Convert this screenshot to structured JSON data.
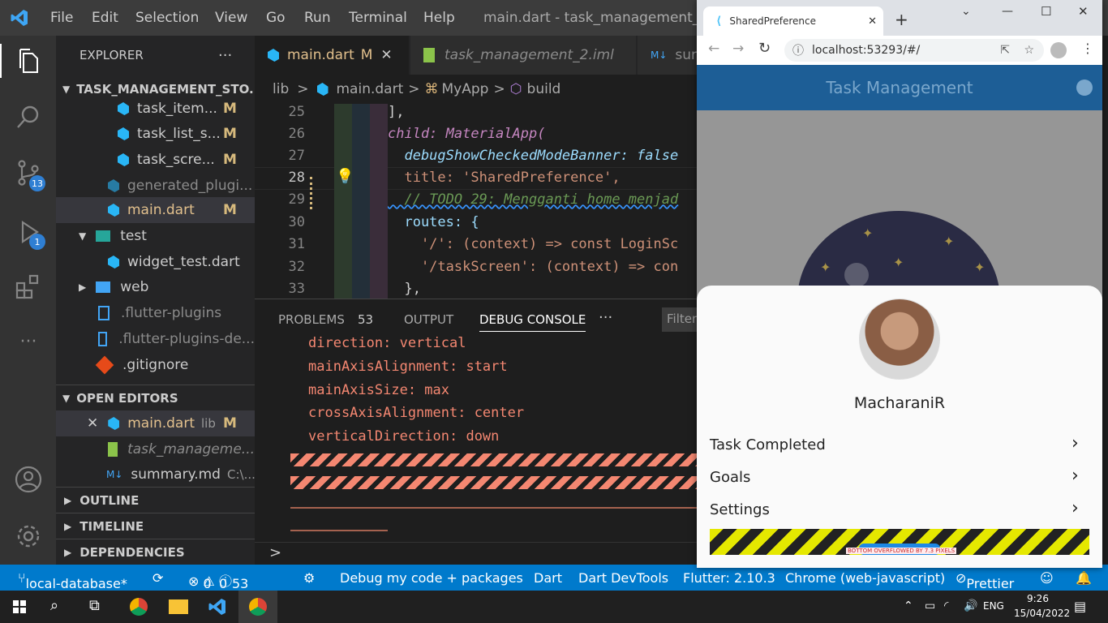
{
  "titlebar": {
    "menus": [
      "File",
      "Edit",
      "Selection",
      "View",
      "Go",
      "Run",
      "Terminal",
      "Help"
    ],
    "title": "main.dart - task_management_stor"
  },
  "activity": {
    "scm_badge": "13",
    "debug_badge": "1"
  },
  "explorer": {
    "title": "EXPLORER",
    "more": "···",
    "project": "TASK_MANAGEMENT_STO...",
    "files": [
      {
        "name": "task_item...",
        "status": "M"
      },
      {
        "name": "task_list_s...",
        "status": "M"
      },
      {
        "name": "task_scre...",
        "status": "M"
      },
      {
        "name": "generated_plugi...",
        "status": ""
      },
      {
        "name": "main.dart",
        "status": "M"
      }
    ],
    "test_folder": "test",
    "test_file": "widget_test.dart",
    "web_folder": "web",
    "other_files": [
      ".flutter-plugins",
      ".flutter-plugins-de...",
      ".gitignore"
    ],
    "open_editors": "OPEN EDITORS",
    "open_files": [
      {
        "name": "main.dart",
        "path": "lib",
        "status": "M"
      },
      {
        "name": "task_manageme...",
        "path": "",
        "status": ""
      },
      {
        "name": "summary.md",
        "path": "C:\\...",
        "status": ""
      }
    ],
    "outline": "OUTLINE",
    "timeline": "TIMELINE",
    "dependencies": "DEPENDENCIES"
  },
  "tabs": [
    {
      "label": "main.dart",
      "status": "M",
      "close": "✕"
    },
    {
      "label": "task_management_2.iml"
    },
    {
      "label": "sur"
    }
  ],
  "breadcrumbs": [
    "lib",
    ">",
    "main.dart",
    ">",
    "MyApp",
    ">",
    "build"
  ],
  "code": {
    "lines": [
      {
        "n": "25",
        "t": "],"
      },
      {
        "n": "26",
        "t": "child: MaterialApp("
      },
      {
        "n": "27",
        "t": "  debugShowCheckedModeBanner: false"
      },
      {
        "n": "28",
        "t": "  title: 'SharedPreference',"
      },
      {
        "n": "29",
        "t": "  // TODO 29: Mengganti home menjad"
      },
      {
        "n": "30",
        "t": "  routes: {"
      },
      {
        "n": "31",
        "t": "    '/': (context) => const LoginSc"
      },
      {
        "n": "32",
        "t": "    '/taskScreen': (context) => con"
      },
      {
        "n": "33",
        "t": "  },"
      }
    ]
  },
  "panel": {
    "problems": "PROBLEMS",
    "problems_count": "53",
    "output": "OUTPUT",
    "debug_console": "DEBUG CONSOLE",
    "more": "···",
    "filter": "Filter",
    "console": [
      "direction: vertical",
      "mainAxisAlignment: start",
      "mainAxisSize: max",
      "crossAxisAlignment: center",
      "verticalDirection: down"
    ],
    "prompt": ">"
  },
  "status": {
    "branch": "local-database*",
    "errors": "0",
    "warnings": "0",
    "info": "53",
    "debug": "Debug my code + packages",
    "dart": "Dart",
    "devtools": "Dart DevTools",
    "flutter": "Flutter: 2.10.3",
    "device": "Chrome (web-javascript)",
    "prettier": "Prettier"
  },
  "taskbar": {
    "lang": "ENG",
    "time": "9:26",
    "date": "15/04/2022"
  },
  "chrome": {
    "tab_title": "SharedPreference",
    "tab_close": "✕",
    "new_tab": "+",
    "url": "localhost:53293/#/",
    "window_min": "—",
    "window_max": "☐",
    "window_close": "✕"
  },
  "app": {
    "title": "Task Management",
    "user": "MacharaniR",
    "menu": [
      "Task Completed",
      "Goals",
      "Settings"
    ],
    "overflow": "BOTTOM OVERFLOWED BY 7.3 PIXELS"
  }
}
